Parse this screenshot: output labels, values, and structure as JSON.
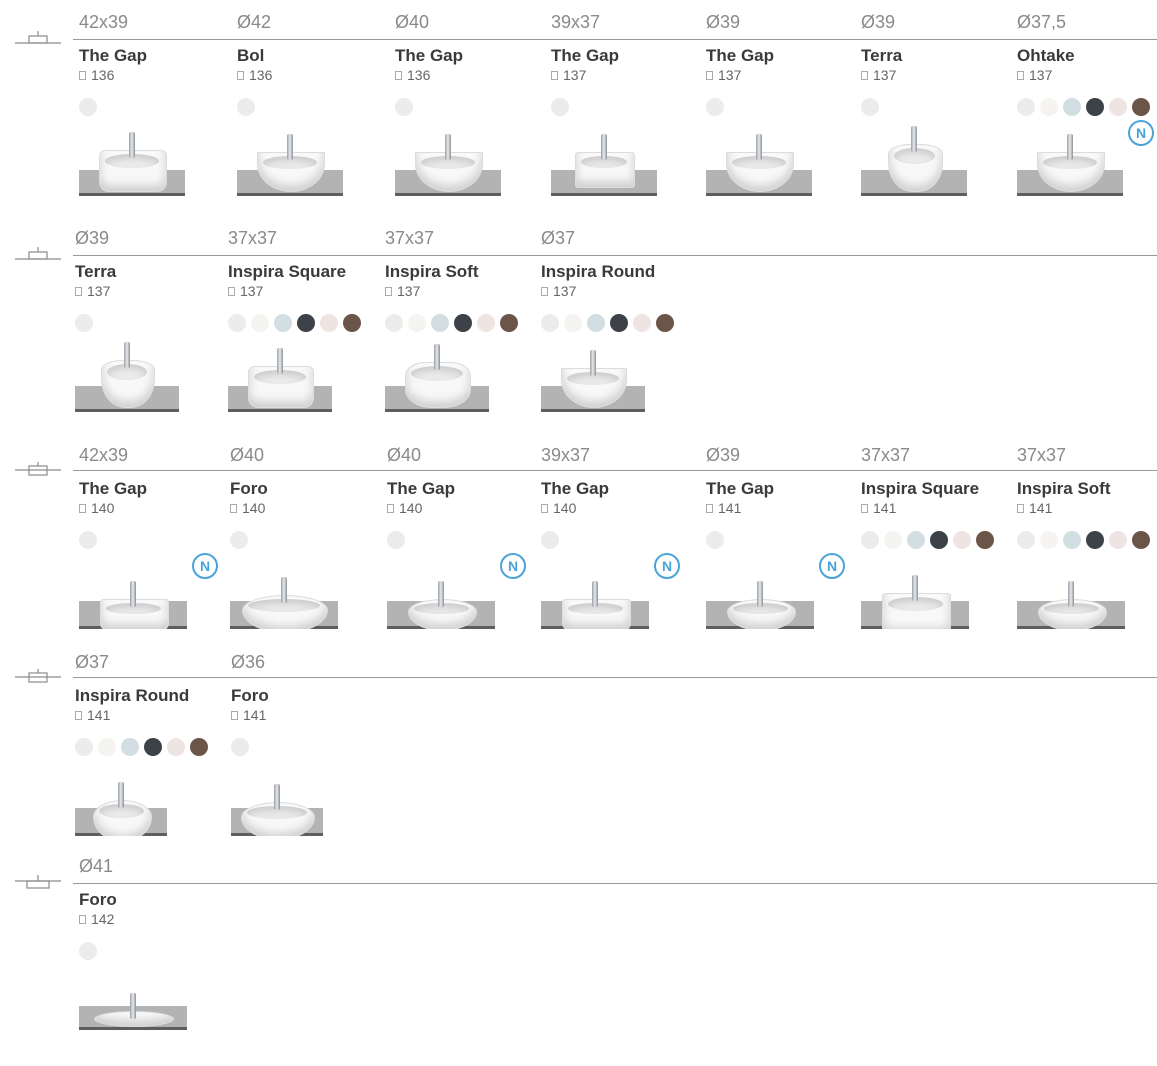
{
  "colors": {
    "rule": "#9a9a9a",
    "counter": "#b3b3b3",
    "new_badge": "#4aa3d8",
    "swatch_white": "#ececec",
    "swatch_offwhite": "#f6f4f1",
    "swatch_lightblue": "#d3dee2",
    "swatch_darkgrey": "#3d4248",
    "swatch_pink": "#eee4e2",
    "swatch_brown": "#6b5448"
  },
  "new_badge_label": "N",
  "sections": [
    {
      "mount_icon": "countertop-mount-icon",
      "items": [
        {
          "dimension": "42x39",
          "name": "The Gap",
          "page": "136",
          "swatches": [
            "#ececec"
          ],
          "basin": "square-rounded",
          "is_new": false
        },
        {
          "dimension": "Ø42",
          "name": "Bol",
          "page": "136",
          "swatches": [
            "#ececec"
          ],
          "basin": "bowl",
          "is_new": false
        },
        {
          "dimension": "Ø40",
          "name": "The Gap",
          "page": "136",
          "swatches": [
            "#ececec"
          ],
          "basin": "round",
          "is_new": false
        },
        {
          "dimension": "39x37",
          "name": "The Gap",
          "page": "137",
          "swatches": [
            "#ececec"
          ],
          "basin": "square",
          "is_new": false
        },
        {
          "dimension": "Ø39",
          "name": "The Gap",
          "page": "137",
          "swatches": [
            "#ececec"
          ],
          "basin": "round",
          "is_new": false
        },
        {
          "dimension": "Ø39",
          "name": "Terra",
          "page": "137",
          "swatches": [
            "#ececec"
          ],
          "basin": "cylinder",
          "is_new": false
        },
        {
          "dimension": "Ø37,5",
          "name": "Ohtake",
          "page": "137",
          "swatches": [
            "#ececec",
            "#f6f4f1",
            "#d3dee2",
            "#3d4248",
            "#eee4e2",
            "#6b5448"
          ],
          "basin": "shell",
          "is_new": true
        }
      ]
    },
    {
      "mount_icon": "countertop-mount-icon",
      "items": [
        {
          "dimension": "Ø39",
          "name": "Terra",
          "page": "137",
          "swatches": [
            "#ececec"
          ],
          "basin": "cylinder",
          "is_new": false
        },
        {
          "dimension": "37x37",
          "name": "Inspira Square",
          "page": "137",
          "swatches": [
            "#ececec",
            "#f6f4f1",
            "#d3dee2",
            "#3d4248",
            "#eee4e2",
            "#6b5448"
          ],
          "basin": "square-rounded",
          "is_new": false
        },
        {
          "dimension": "37x37",
          "name": "Inspira Soft",
          "page": "137",
          "swatches": [
            "#ececec",
            "#f6f4f1",
            "#d3dee2",
            "#3d4248",
            "#eee4e2",
            "#6b5448"
          ],
          "basin": "soft",
          "is_new": false
        },
        {
          "dimension": "Ø37",
          "name": "Inspira Round",
          "page": "137",
          "swatches": [
            "#ececec",
            "#f6f4f1",
            "#d3dee2",
            "#3d4248",
            "#eee4e2",
            "#6b5448"
          ],
          "basin": "round",
          "is_new": false
        }
      ]
    },
    {
      "mount_icon": "semi-recessed-mount-icon",
      "items": [
        {
          "dimension": "42x39",
          "name": "The Gap",
          "page": "140",
          "swatches": [
            "#ececec"
          ],
          "basin": "semi-square",
          "is_new": true
        },
        {
          "dimension": "Ø40",
          "name": "Foro",
          "page": "140",
          "swatches": [
            "#ececec"
          ],
          "basin": "semi-oval",
          "is_new": false
        },
        {
          "dimension": "Ø40",
          "name": "The Gap",
          "page": "140",
          "swatches": [
            "#ececec"
          ],
          "basin": "semi-round",
          "is_new": true
        },
        {
          "dimension": "39x37",
          "name": "The Gap",
          "page": "140",
          "swatches": [
            "#ececec"
          ],
          "basin": "semi-square",
          "is_new": true
        },
        {
          "dimension": "Ø39",
          "name": "The Gap",
          "page": "141",
          "swatches": [
            "#ececec"
          ],
          "basin": "semi-round",
          "is_new": true
        },
        {
          "dimension": "37x37",
          "name": "Inspira Square",
          "page": "141",
          "swatches": [
            "#ececec",
            "#f6f4f1",
            "#d3dee2",
            "#3d4248",
            "#eee4e2",
            "#6b5448"
          ],
          "basin": "semi-square-tall",
          "is_new": false
        },
        {
          "dimension": "37x37",
          "name": "Inspira Soft",
          "page": "141",
          "swatches": [
            "#ececec",
            "#f6f4f1",
            "#d3dee2",
            "#3d4248",
            "#eee4e2",
            "#6b5448"
          ],
          "basin": "semi-soft",
          "is_new": false
        }
      ]
    },
    {
      "mount_icon": "semi-recessed-mount-icon",
      "items": [
        {
          "dimension": "Ø37",
          "name": "Inspira Round",
          "page": "141",
          "swatches": [
            "#ececec",
            "#f6f4f1",
            "#d3dee2",
            "#3d4248",
            "#eee4e2",
            "#6b5448"
          ],
          "basin": "semi-round-tall",
          "is_new": false
        },
        {
          "dimension": "Ø36",
          "name": "Foro",
          "page": "141",
          "swatches": [
            "#ececec"
          ],
          "basin": "semi-oval",
          "is_new": false
        }
      ]
    },
    {
      "mount_icon": "undercounter-mount-icon",
      "items": [
        {
          "dimension": "Ø41",
          "name": "Foro",
          "page": "142",
          "swatches": [
            "#ececec"
          ],
          "basin": "under-oval",
          "is_new": false
        }
      ]
    }
  ]
}
